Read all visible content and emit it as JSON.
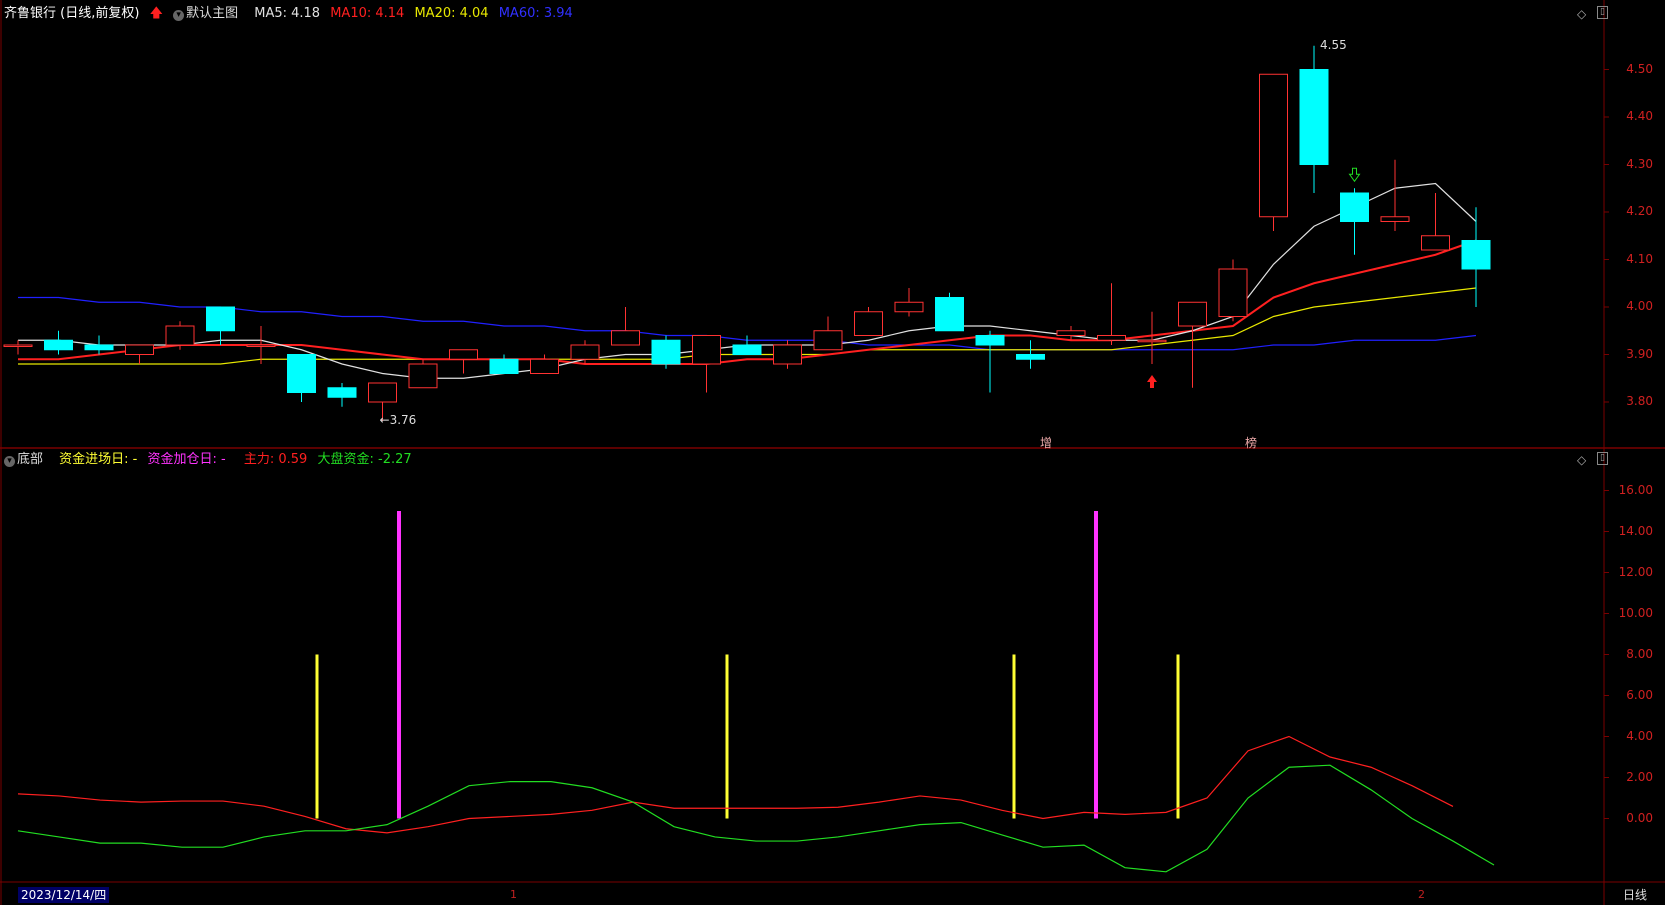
{
  "colors": {
    "background": "#000000",
    "up": "#ff3232",
    "down": "#00ffff",
    "ma5": "#e0e0e0",
    "ma10": "#ff2020",
    "ma20": "#e8e800",
    "ma60": "#2020ff",
    "grid": "#7a0000",
    "main_force": "#ff2020",
    "market_fund": "#22dd22",
    "entry_bar": "#ffff33",
    "add_bar": "#ff33ff"
  },
  "header": {
    "title": "齐鲁银行 (日线,前复权)",
    "main_chart_label": "默认主图",
    "ma5": "MA5: 4.18",
    "ma10": "MA10: 4.14",
    "ma20": "MA20: 4.04",
    "ma60": "MA60: 3.94"
  },
  "sub_header": {
    "indicator": "底部",
    "entry_day": "资金进场日: -",
    "add_day": "资金加仓日: -",
    "main_force": "主力: 0.59",
    "market_fund": "大盘资金: -2.27"
  },
  "price_axis": [
    "4.50",
    "4.40",
    "4.30",
    "4.20",
    "4.10",
    "4.00",
    "3.90",
    "3.80"
  ],
  "sub_axis": [
    "16.00",
    "14.00",
    "12.00",
    "10.00",
    "8.00",
    "6.00",
    "4.00",
    "2.00",
    "0.00"
  ],
  "annotations": {
    "high": "4.55",
    "low": "3.76",
    "mark_zeng": "增",
    "mark_bang": "榜"
  },
  "footer": {
    "date": "2023/12/14/四",
    "period": "日线",
    "month_1": "1",
    "month_2": "2"
  },
  "chart_data": [
    {
      "type": "candlestick",
      "title": "齐鲁银行 (日线,前复权)",
      "ylim": [
        3.72,
        4.6
      ],
      "candles": [
        {
          "o": 3.92,
          "h": 3.93,
          "l": 3.9,
          "c": 3.92
        },
        {
          "o": 3.93,
          "h": 3.95,
          "l": 3.9,
          "c": 3.91
        },
        {
          "o": 3.92,
          "h": 3.94,
          "l": 3.9,
          "c": 3.91
        },
        {
          "o": 3.9,
          "h": 3.92,
          "l": 3.88,
          "c": 3.92
        },
        {
          "o": 3.92,
          "h": 3.97,
          "l": 3.91,
          "c": 3.96
        },
        {
          "o": 4.0,
          "h": 4.0,
          "l": 3.92,
          "c": 3.95
        },
        {
          "o": 3.92,
          "h": 3.96,
          "l": 3.88,
          "c": 3.92
        },
        {
          "o": 3.9,
          "h": 3.9,
          "l": 3.8,
          "c": 3.82
        },
        {
          "o": 3.83,
          "h": 3.84,
          "l": 3.79,
          "c": 3.81
        },
        {
          "o": 3.8,
          "h": 3.84,
          "l": 3.76,
          "c": 3.84
        },
        {
          "o": 3.83,
          "h": 3.89,
          "l": 3.83,
          "c": 3.88
        },
        {
          "o": 3.89,
          "h": 3.91,
          "l": 3.86,
          "c": 3.91
        },
        {
          "o": 3.89,
          "h": 3.9,
          "l": 3.86,
          "c": 3.86
        },
        {
          "o": 3.86,
          "h": 3.9,
          "l": 3.86,
          "c": 3.89
        },
        {
          "o": 3.89,
          "h": 3.93,
          "l": 3.88,
          "c": 3.92
        },
        {
          "o": 3.92,
          "h": 4.0,
          "l": 3.92,
          "c": 3.95
        },
        {
          "o": 3.93,
          "h": 3.94,
          "l": 3.87,
          "c": 3.88
        },
        {
          "o": 3.88,
          "h": 3.94,
          "l": 3.82,
          "c": 3.94
        },
        {
          "o": 3.92,
          "h": 3.94,
          "l": 3.9,
          "c": 3.9
        },
        {
          "o": 3.88,
          "h": 3.93,
          "l": 3.87,
          "c": 3.92
        },
        {
          "o": 3.91,
          "h": 3.98,
          "l": 3.91,
          "c": 3.95
        },
        {
          "o": 3.94,
          "h": 4.0,
          "l": 3.94,
          "c": 3.99
        },
        {
          "o": 3.99,
          "h": 4.04,
          "l": 3.98,
          "c": 4.01
        },
        {
          "o": 4.02,
          "h": 4.03,
          "l": 3.95,
          "c": 3.95
        },
        {
          "o": 3.94,
          "h": 3.95,
          "l": 3.82,
          "c": 3.92
        },
        {
          "o": 3.9,
          "h": 3.93,
          "l": 3.87,
          "c": 3.89
        },
        {
          "o": 3.94,
          "h": 3.96,
          "l": 3.93,
          "c": 3.95
        },
        {
          "o": 3.93,
          "h": 4.05,
          "l": 3.92,
          "c": 3.94
        },
        {
          "o": 3.93,
          "h": 3.99,
          "l": 3.88,
          "c": 3.93
        },
        {
          "o": 3.96,
          "h": 4.01,
          "l": 3.83,
          "c": 4.01
        },
        {
          "o": 3.98,
          "h": 4.1,
          "l": 3.97,
          "c": 4.08
        },
        {
          "o": 4.19,
          "h": 4.49,
          "l": 4.16,
          "c": 4.49
        },
        {
          "o": 4.5,
          "h": 4.55,
          "l": 4.24,
          "c": 4.3
        },
        {
          "o": 4.24,
          "h": 4.25,
          "l": 4.11,
          "c": 4.18
        },
        {
          "o": 4.18,
          "h": 4.31,
          "l": 4.16,
          "c": 4.19
        },
        {
          "o": 4.12,
          "h": 4.24,
          "l": 4.12,
          "c": 4.15
        },
        {
          "o": 4.14,
          "h": 4.21,
          "l": 4.0,
          "c": 4.08
        }
      ],
      "ma5": [
        3.93,
        3.93,
        3.92,
        3.92,
        3.92,
        3.93,
        3.93,
        3.91,
        3.88,
        3.86,
        3.85,
        3.85,
        3.86,
        3.87,
        3.89,
        3.9,
        3.9,
        3.91,
        3.92,
        3.92,
        3.92,
        3.93,
        3.95,
        3.96,
        3.96,
        3.95,
        3.94,
        3.93,
        3.93,
        3.95,
        3.98,
        4.09,
        4.17,
        4.21,
        4.25,
        4.26,
        4.18
      ],
      "ma10": [
        3.89,
        3.89,
        3.9,
        3.91,
        3.92,
        3.92,
        3.92,
        3.92,
        3.91,
        3.9,
        3.89,
        3.89,
        3.89,
        3.89,
        3.88,
        3.88,
        3.88,
        3.88,
        3.89,
        3.89,
        3.9,
        3.91,
        3.92,
        3.93,
        3.94,
        3.94,
        3.93,
        3.93,
        3.94,
        3.95,
        3.96,
        4.02,
        4.05,
        4.07,
        4.09,
        4.11,
        4.14
      ],
      "ma20": [
        3.88,
        3.88,
        3.88,
        3.88,
        3.88,
        3.88,
        3.89,
        3.89,
        3.89,
        3.89,
        3.89,
        3.89,
        3.89,
        3.89,
        3.89,
        3.89,
        3.89,
        3.9,
        3.9,
        3.9,
        3.9,
        3.91,
        3.91,
        3.91,
        3.91,
        3.91,
        3.91,
        3.91,
        3.92,
        3.93,
        3.94,
        3.98,
        4.0,
        4.01,
        4.02,
        4.03,
        4.04
      ],
      "ma60": [
        4.02,
        4.02,
        4.01,
        4.01,
        4.0,
        4.0,
        3.99,
        3.99,
        3.98,
        3.98,
        3.97,
        3.97,
        3.96,
        3.96,
        3.95,
        3.95,
        3.94,
        3.94,
        3.93,
        3.93,
        3.93,
        3.92,
        3.92,
        3.92,
        3.91,
        3.91,
        3.91,
        3.91,
        3.91,
        3.91,
        3.91,
        3.92,
        3.92,
        3.93,
        3.93,
        3.93,
        3.94
      ],
      "markers": {
        "high": {
          "index": 32,
          "value": 4.55
        },
        "low": {
          "index": 9,
          "value": 3.76
        },
        "buy_arrow_index": 28,
        "sell_arrow_index": 33
      }
    },
    {
      "type": "line",
      "title": "底部",
      "ylim": [
        -3,
        17
      ],
      "series": [
        {
          "name": "主力",
          "values": [
            1.2,
            1.1,
            0.9,
            0.8,
            0.85,
            0.85,
            0.6,
            0.1,
            -0.5,
            -0.7,
            -0.4,
            0.0,
            0.1,
            0.2,
            0.4,
            0.8,
            0.5,
            0.5,
            0.5,
            0.5,
            0.55,
            0.8,
            1.1,
            0.9,
            0.4,
            0.0,
            0.3,
            0.2,
            0.3,
            1.0,
            3.3,
            4.0,
            3.0,
            2.5,
            1.6,
            0.59
          ]
        },
        {
          "name": "大盘资金",
          "values": [
            -0.6,
            -0.9,
            -1.2,
            -1.2,
            -1.4,
            -1.4,
            -0.9,
            -0.6,
            -0.6,
            -0.3,
            0.6,
            1.6,
            1.8,
            1.8,
            1.5,
            0.8,
            -0.4,
            -0.9,
            -1.1,
            -1.1,
            -0.9,
            -0.6,
            -0.3,
            -0.2,
            -0.8,
            -1.4,
            -1.3,
            -2.4,
            -2.6,
            -1.5,
            1.0,
            2.5,
            2.6,
            1.4,
            0.0,
            -1.1,
            -2.27
          ]
        }
      ],
      "entry_bars": [
        {
          "index": 7,
          "value": 8
        },
        {
          "index": 17,
          "value": 8
        },
        {
          "index": 24,
          "value": 8
        },
        {
          "index": 28,
          "value": 8
        }
      ],
      "add_bars": [
        {
          "index": 9,
          "value": 15
        },
        {
          "index": 26,
          "value": 15
        }
      ]
    }
  ]
}
